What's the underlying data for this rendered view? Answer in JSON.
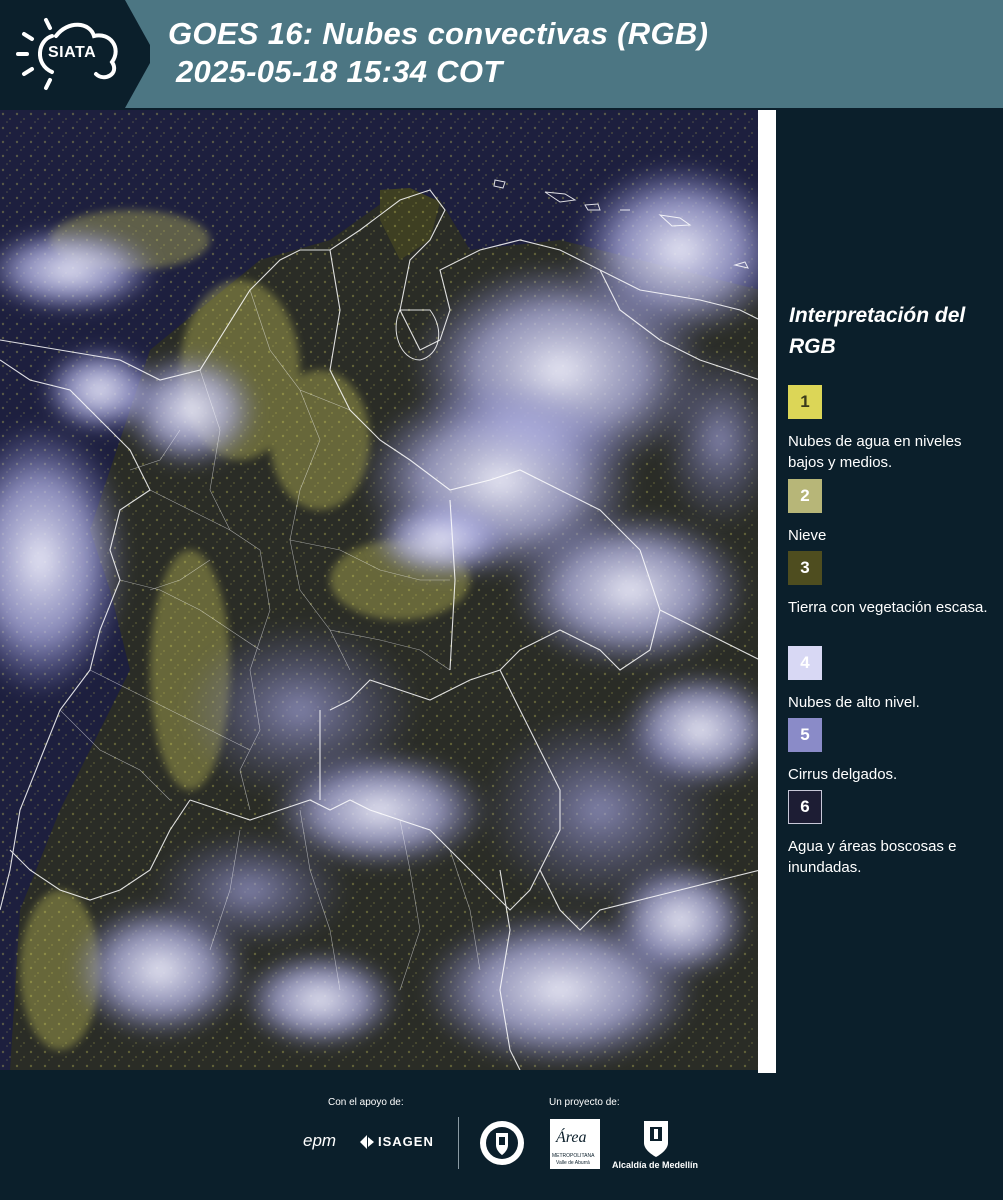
{
  "header": {
    "logo_text": "SIATA",
    "title_line1": "GOES 16: Nubes convectivas (RGB)",
    "title_line2": "2025-05-18 15:34 COT"
  },
  "legend": {
    "title": "Interpretación del RGB",
    "items": [
      {
        "number": "1",
        "label": "Nubes de agua en niveles bajos y medios.",
        "color": "#dcd657",
        "text_color": "#3a3a1c"
      },
      {
        "number": "2",
        "label": "Nieve",
        "color": "#b7b678",
        "text_color": "#ffffff"
      },
      {
        "number": "3",
        "label": "Tierra con vegetación escasa.",
        "color": "#4e4d1f",
        "text_color": "#ffffff"
      },
      {
        "number": "4",
        "label": "Nubes de alto nivel.",
        "color": "#d8d8f4",
        "text_color": "#ffffff"
      },
      {
        "number": "5",
        "label": "Cirrus delgados.",
        "color": "#8a8bc8",
        "text_color": "#ffffff"
      },
      {
        "number": "6",
        "label": "Agua y áreas boscosas e inundadas.",
        "color": "#1d1d34",
        "text_color": "#ffffff"
      }
    ]
  },
  "footer": {
    "support_label": "Con el apoyo de:",
    "project_label": "Un proyecto de:",
    "sponsors": [
      "epm",
      "ISAGEN"
    ],
    "partners": [
      "Área Metropolitana Valle de Aburrá",
      "Alcaldía de Medellín"
    ],
    "area_text": "Área",
    "area_subtext": "METROPOLITANA",
    "area_subtext2": "Valle de Aburrá",
    "alcaldia_text": "Alcaldía de Medellín"
  },
  "colors": {
    "background": "#0b1f2b",
    "header_band": "#4c7683",
    "map_water": "#1c1e3c",
    "cloud_high": "#d8d8f4",
    "cloud_low": "#dcd657"
  }
}
